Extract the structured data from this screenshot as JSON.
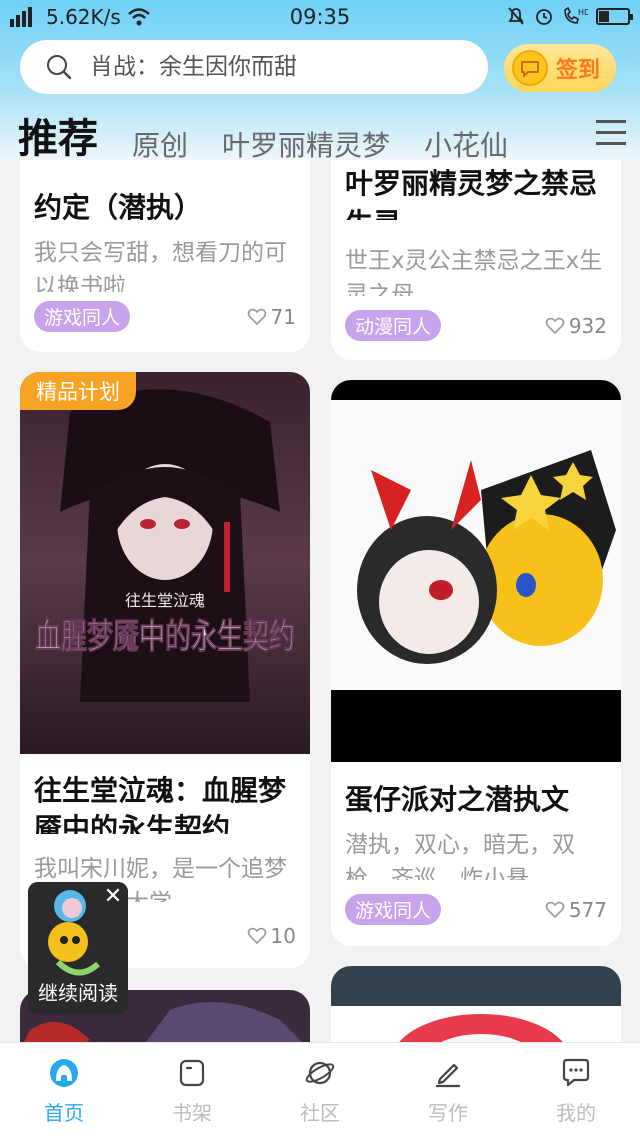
{
  "status_bar": {
    "signal": "4G",
    "speed": "5.62K/s",
    "time": "09:35",
    "battery_level": 0.35
  },
  "search": {
    "placeholder": "肖战：余生因你而甜",
    "icon": "search-icon"
  },
  "signin": {
    "label": "签到",
    "icon": "coin-icon"
  },
  "tabs": [
    {
      "label": "推荐",
      "active": true
    },
    {
      "label": "原创",
      "active": false
    },
    {
      "label": "叶罗丽精灵梦",
      "active": false
    },
    {
      "label": "小花仙",
      "active": false
    }
  ],
  "cards": [
    {
      "title": "约定（潜执）",
      "desc": "我只会写甜，想看刀的可以换书啦",
      "tag": "游戏同人",
      "likes": "71"
    },
    {
      "title": "叶罗丽精灵梦之禁忌生灵",
      "desc": "世王x灵公主禁忌之王x生灵之母",
      "tag": "动漫同人",
      "likes": "932"
    },
    {
      "badge": "精品计划",
      "cover_title": "血腥梦魇中的永生契约",
      "cover_subtitle": "往生堂泣魂",
      "title": "往生堂泣魂：血腥梦魇中的永生契约",
      "desc": "我叫宋川妮，是一个追梦的暗叫京大学",
      "likes": "10"
    },
    {
      "title": "蛋仔派对之潜执文",
      "desc": "潜执，双心，暗无，双枪，齐巡，炸小悬",
      "tag": "游戏同人",
      "likes": "577"
    }
  ],
  "continue_reading": {
    "label": "继续阅读"
  },
  "bottom_nav": [
    {
      "label": "首页",
      "icon": "home-icon",
      "active": true
    },
    {
      "label": "书架",
      "icon": "bookshelf-icon",
      "active": false
    },
    {
      "label": "社区",
      "icon": "planet-icon",
      "active": false
    },
    {
      "label": "写作",
      "icon": "pen-icon",
      "active": false
    },
    {
      "label": "我的",
      "icon": "message-icon",
      "active": false
    }
  ],
  "colors": {
    "accent": "#2aa8ef",
    "tag_purple": "#c6a3ea",
    "badge_orange": "#f7a324",
    "signin_text": "#ff7a1a"
  }
}
